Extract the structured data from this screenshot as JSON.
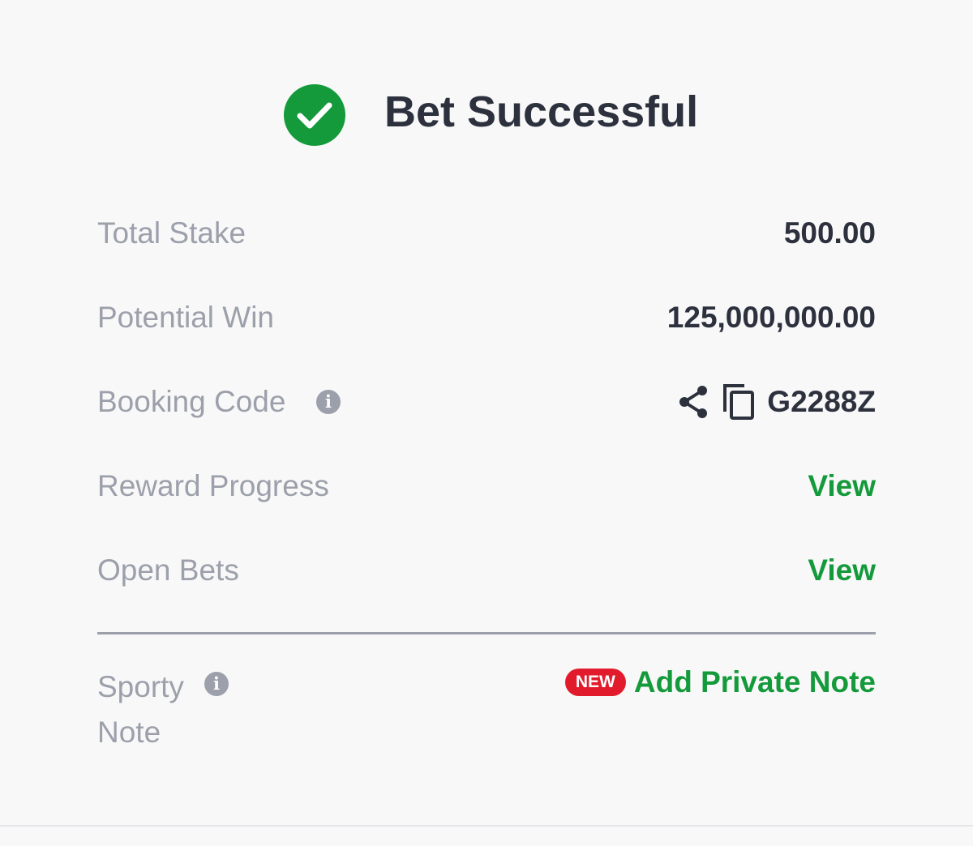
{
  "header": {
    "title": "Bet Successful",
    "status_icon": "check-circle-icon",
    "status_color": "#149a3b"
  },
  "summary": {
    "total_stake": {
      "label": "Total Stake",
      "value": "500.00"
    },
    "potential_win": {
      "label": "Potential Win",
      "value": "125,000,000.00"
    },
    "booking_code": {
      "label": "Booking Code",
      "info_icon": "info-icon",
      "share_icon": "share-icon",
      "copy_icon": "copy-icon",
      "code": "G2288Z"
    },
    "reward_progress": {
      "label": "Reward Progress",
      "action": "View"
    },
    "open_bets": {
      "label": "Open Bets",
      "action": "View"
    }
  },
  "note": {
    "label_line1": "Sporty",
    "label_line2": "Note",
    "info_icon": "info-icon",
    "badge": "NEW",
    "action": "Add Private Note"
  },
  "colors": {
    "accent": "#149a3b",
    "badge": "#e21b2c",
    "text_primary": "#2c313d",
    "text_secondary": "#9ca0aa",
    "background": "#f8f8f9"
  }
}
